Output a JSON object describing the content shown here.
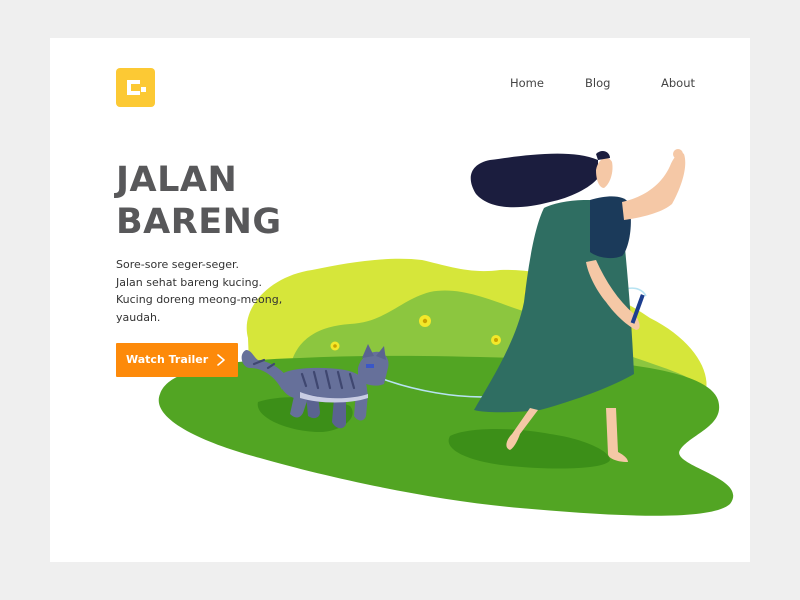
{
  "header": {
    "logo_icon": "brand-logo-icon",
    "nav": [
      {
        "label": "Home"
      },
      {
        "label": "Blog"
      },
      {
        "label": "About"
      }
    ]
  },
  "hero": {
    "title_lines": [
      "JALAN",
      "BARENG"
    ],
    "description_lines": [
      "Sore-sore seger-seger.",
      "Jalan sehat bareng kucing.",
      "Kucing doreng meong-meong,",
      "yaudah."
    ],
    "cta_label": "Watch Trailer",
    "cta_icon": "chevron-right-icon"
  },
  "illustration": {
    "subject": "woman-walking-cat-illustration"
  },
  "colors": {
    "background": "#efefef",
    "card": "#ffffff",
    "logo": "#fcc934",
    "cta": "#fd8a0a",
    "title": "#58585a",
    "grass": "#52a523",
    "bush_light": "#d6e63a",
    "bush_mid": "#8cc63f",
    "dress": "#2f6e62",
    "hair": "#1b1d3e",
    "cat": "#66709a"
  }
}
